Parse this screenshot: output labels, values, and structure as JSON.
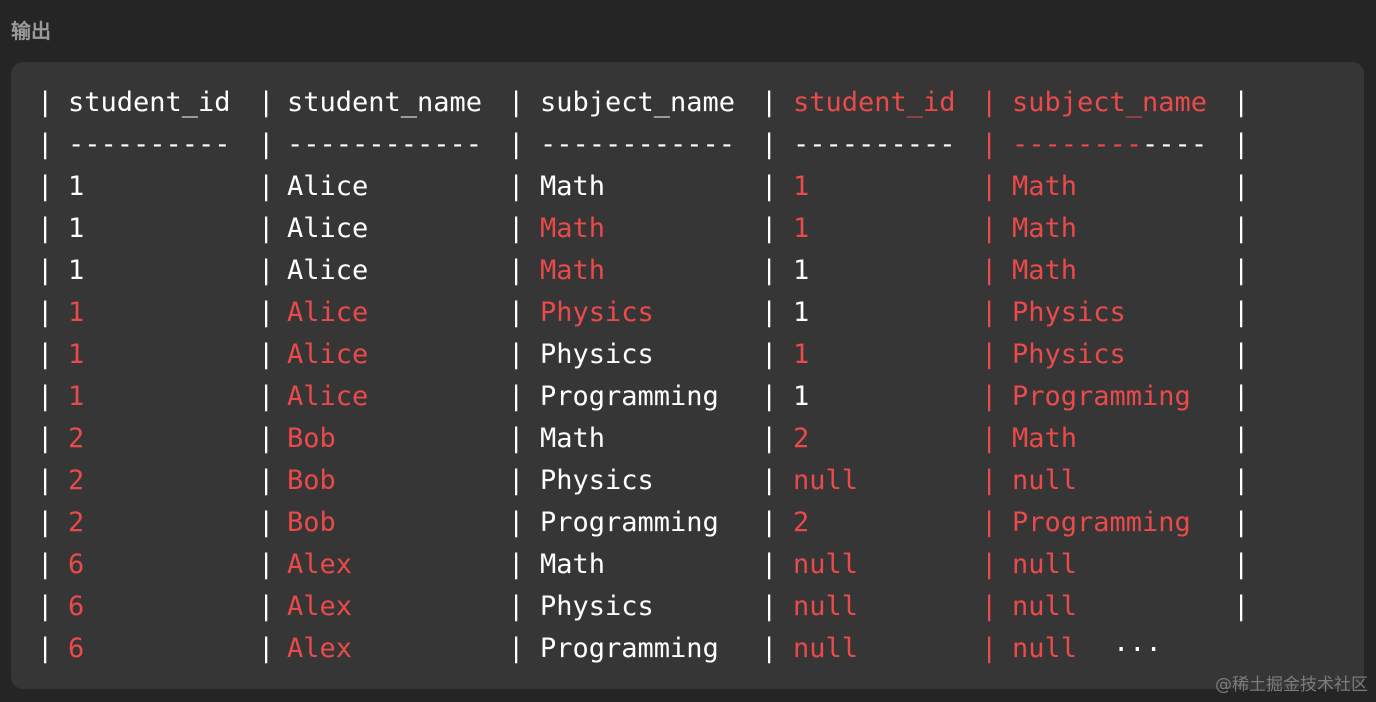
{
  "heading": "输出",
  "watermark": "@稀土掘金技术社区",
  "ellipsis": "...",
  "colors": {
    "background": "#252525",
    "panel": "#363636",
    "text": "#ffffff",
    "highlight": "#ea4a4a"
  },
  "table": {
    "header": [
      "student_id",
      "student_name",
      "subject_name",
      "student_id",
      "subject_name"
    ],
    "header_highlight": [
      false,
      false,
      false,
      true,
      true
    ],
    "separator": [
      "----------",
      "------------",
      "------------",
      "----------",
      "------------"
    ],
    "rows": [
      {
        "cells": [
          "1",
          "Alice",
          "Math",
          "1",
          "Math"
        ],
        "highlight": [
          false,
          false,
          false,
          true,
          true
        ]
      },
      {
        "cells": [
          "1",
          "Alice",
          "Math",
          "1",
          "Math"
        ],
        "highlight": [
          false,
          false,
          true,
          true,
          true
        ]
      },
      {
        "cells": [
          "1",
          "Alice",
          "Math",
          "1",
          "Math"
        ],
        "highlight": [
          false,
          false,
          true,
          false,
          true
        ]
      },
      {
        "cells": [
          "1",
          "Alice",
          "Physics",
          "1",
          "Physics"
        ],
        "highlight": [
          true,
          true,
          true,
          false,
          true
        ]
      },
      {
        "cells": [
          "1",
          "Alice",
          "Physics",
          "1",
          "Physics"
        ],
        "highlight": [
          true,
          true,
          false,
          true,
          true
        ]
      },
      {
        "cells": [
          "1",
          "Alice",
          "Programming",
          "1",
          "Programming"
        ],
        "highlight": [
          true,
          true,
          false,
          false,
          true
        ]
      },
      {
        "cells": [
          "2",
          "Bob",
          "Math",
          "2",
          "Math"
        ],
        "highlight": [
          true,
          true,
          false,
          true,
          true
        ]
      },
      {
        "cells": [
          "2",
          "Bob",
          "Physics",
          "null",
          "null"
        ],
        "highlight": [
          true,
          true,
          false,
          true,
          true
        ]
      },
      {
        "cells": [
          "2",
          "Bob",
          "Programming",
          "2",
          "Programming"
        ],
        "highlight": [
          true,
          true,
          false,
          true,
          true
        ]
      },
      {
        "cells": [
          "6",
          "Alex",
          "Math",
          "null",
          "null"
        ],
        "highlight": [
          true,
          true,
          false,
          true,
          true
        ]
      },
      {
        "cells": [
          "6",
          "Alex",
          "Physics",
          "null",
          "null"
        ],
        "highlight": [
          true,
          true,
          false,
          true,
          true
        ]
      },
      {
        "cells": [
          "6",
          "Alex",
          "Programming",
          "null",
          "null"
        ],
        "highlight": [
          true,
          true,
          false,
          true,
          true
        ]
      }
    ]
  }
}
